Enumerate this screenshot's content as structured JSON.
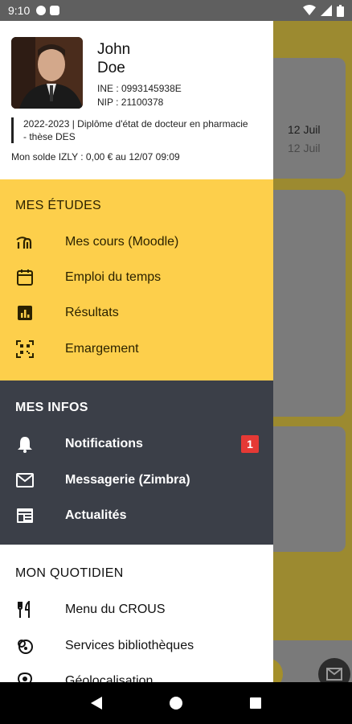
{
  "status_bar": {
    "time": "9:10"
  },
  "background": {
    "date_primary": "12 Juil",
    "date_secondary": "12 Juil"
  },
  "profile": {
    "first_name": "John",
    "last_name": "Doe",
    "ine": "INE : 0993145938E",
    "nip": "NIP : 21100378",
    "diploma": "2022-2023 | Diplôme d'état de docteur en pharmacie - thèse DES",
    "balance": "Mon solde IZLY : 0,00 € au 12/07 09:09"
  },
  "sections": {
    "etudes": {
      "title": "MES ÉTUDES",
      "items": [
        {
          "label": "Mes cours (Moodle)",
          "icon": "moodle-icon"
        },
        {
          "label": "Emploi du temps",
          "icon": "calendar-icon"
        },
        {
          "label": "Résultats",
          "icon": "bar-chart-icon"
        },
        {
          "label": "Emargement",
          "icon": "qr-scan-icon"
        }
      ]
    },
    "infos": {
      "title": "MES INFOS",
      "items": [
        {
          "label": "Notifications",
          "icon": "bell-icon",
          "badge": "1"
        },
        {
          "label": "Messagerie (Zimbra)",
          "icon": "mail-icon"
        },
        {
          "label": "Actualités",
          "icon": "news-icon"
        }
      ]
    },
    "quotidien": {
      "title": "MON QUOTIDIEN",
      "items": [
        {
          "label": "Menu du CROUS",
          "icon": "restaurant-icon"
        },
        {
          "label": "Services bibliothèques",
          "icon": "library-icon"
        },
        {
          "label": "Géolocalisation",
          "icon": "location-icon"
        }
      ]
    }
  },
  "colors": {
    "etudes_bg": "#fdcf4b",
    "infos_bg": "#3b3f48",
    "badge": "#e53935"
  }
}
